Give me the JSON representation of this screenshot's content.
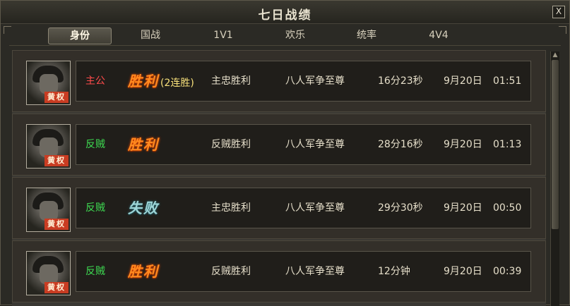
{
  "window": {
    "title": "七日战绩",
    "close_label": "X"
  },
  "tabs": [
    {
      "label": "身份"
    },
    {
      "label": "国战"
    },
    {
      "label": "1V1"
    },
    {
      "label": "欢乐"
    },
    {
      "label": "统率"
    },
    {
      "label": "4V4"
    }
  ],
  "active_tab": "身份",
  "colors": {
    "win": "#ff8a1f",
    "lose": "#9fd6d8",
    "lord": "#ff4b4b",
    "rebel": "#3edc52"
  },
  "records": [
    {
      "avatar_icon": "general-portrait-icon",
      "name_tag": "黄权",
      "identity": "主公",
      "identity_color": "red",
      "result": "胜利",
      "result_type": "win",
      "streak": "(2连胜)",
      "outcome": "主忠胜利",
      "mode": "八人军争至尊",
      "duration": "16分23秒",
      "date": "9月20日",
      "time": "01:51"
    },
    {
      "avatar_icon": "general-portrait-icon",
      "name_tag": "黄权",
      "identity": "反贼",
      "identity_color": "green",
      "result": "胜利",
      "result_type": "win",
      "streak": "",
      "outcome": "反贼胜利",
      "mode": "八人军争至尊",
      "duration": "28分16秒",
      "date": "9月20日",
      "time": "01:13"
    },
    {
      "avatar_icon": "general-portrait-icon",
      "name_tag": "黄权",
      "identity": "反贼",
      "identity_color": "green",
      "result": "失败",
      "result_type": "lose",
      "streak": "",
      "outcome": "主忠胜利",
      "mode": "八人军争至尊",
      "duration": "29分30秒",
      "date": "9月20日",
      "time": "00:50"
    },
    {
      "avatar_icon": "general-portrait-icon",
      "name_tag": "黄权",
      "identity": "反贼",
      "identity_color": "green",
      "result": "胜利",
      "result_type": "win",
      "streak": "",
      "outcome": "反贼胜利",
      "mode": "八人军争至尊",
      "duration": "12分钟",
      "date": "9月20日",
      "time": "00:39"
    }
  ]
}
